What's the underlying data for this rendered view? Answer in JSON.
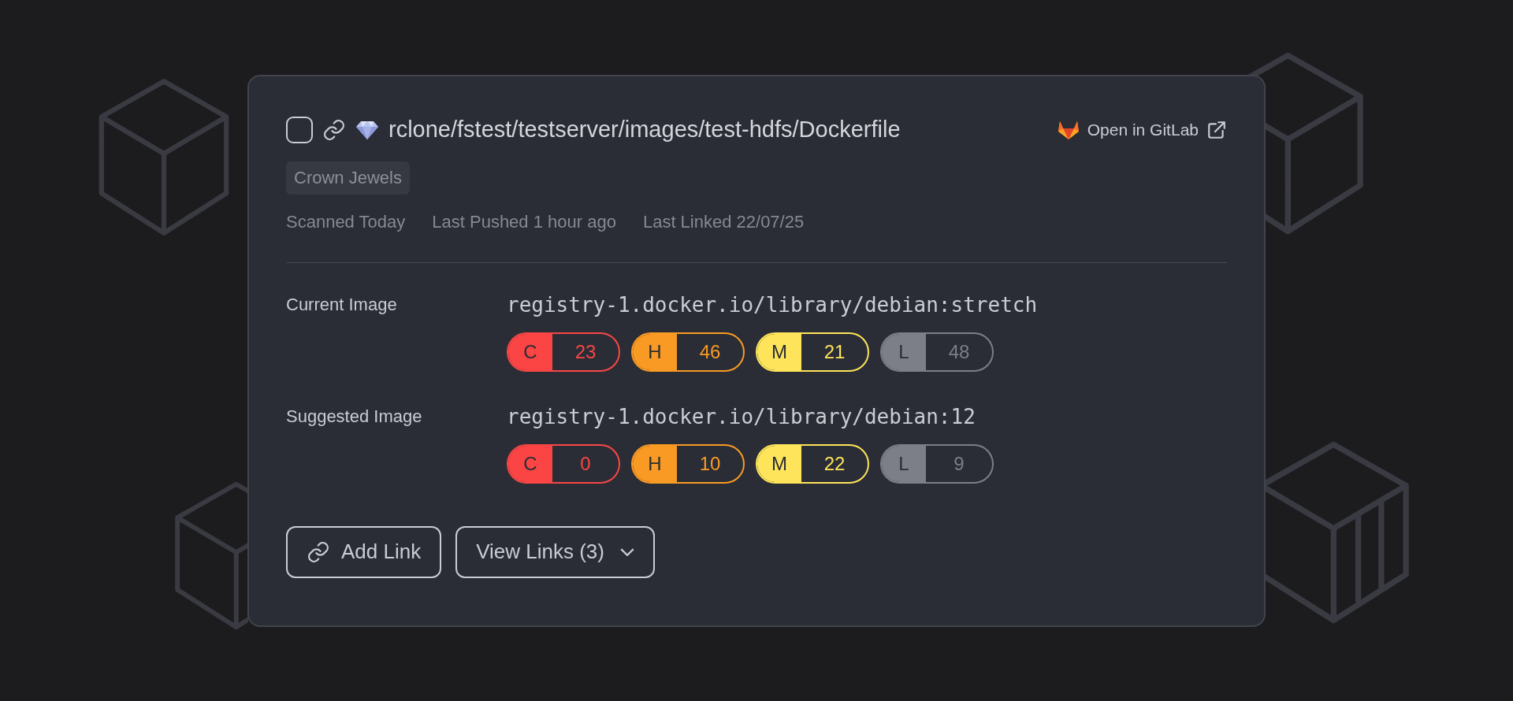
{
  "file": {
    "checked": false,
    "path": "rclone/fstest/testserver/images/test-hdfs/Dockerfile"
  },
  "open_link": {
    "label": "Open in GitLab"
  },
  "tags": [
    "Crown Jewels"
  ],
  "meta": [
    "Scanned Today",
    "Last Pushed 1 hour ago",
    "Last Linked 22/07/25"
  ],
  "images": [
    {
      "label": "Current Image",
      "name": "registry-1.docker.io/library/debian:stretch",
      "severities": [
        {
          "letter": "C",
          "count": "23",
          "color": "#fb4545"
        },
        {
          "letter": "H",
          "count": "46",
          "color": "#f99a24"
        },
        {
          "letter": "M",
          "count": "21",
          "color": "#fde45a"
        },
        {
          "letter": "L",
          "count": "48",
          "color": "#7c7f88"
        }
      ]
    },
    {
      "label": "Suggested Image",
      "name": "registry-1.docker.io/library/debian:12",
      "severities": [
        {
          "letter": "C",
          "count": "0",
          "color": "#fb4545"
        },
        {
          "letter": "H",
          "count": "10",
          "color": "#f99a24"
        },
        {
          "letter": "M",
          "count": "22",
          "color": "#fde45a"
        },
        {
          "letter": "L",
          "count": "9",
          "color": "#7c7f88"
        }
      ]
    }
  ],
  "buttons": [
    {
      "kind": "add",
      "label": "Add Link"
    },
    {
      "kind": "dropdown",
      "label": "View Links (3)"
    }
  ]
}
